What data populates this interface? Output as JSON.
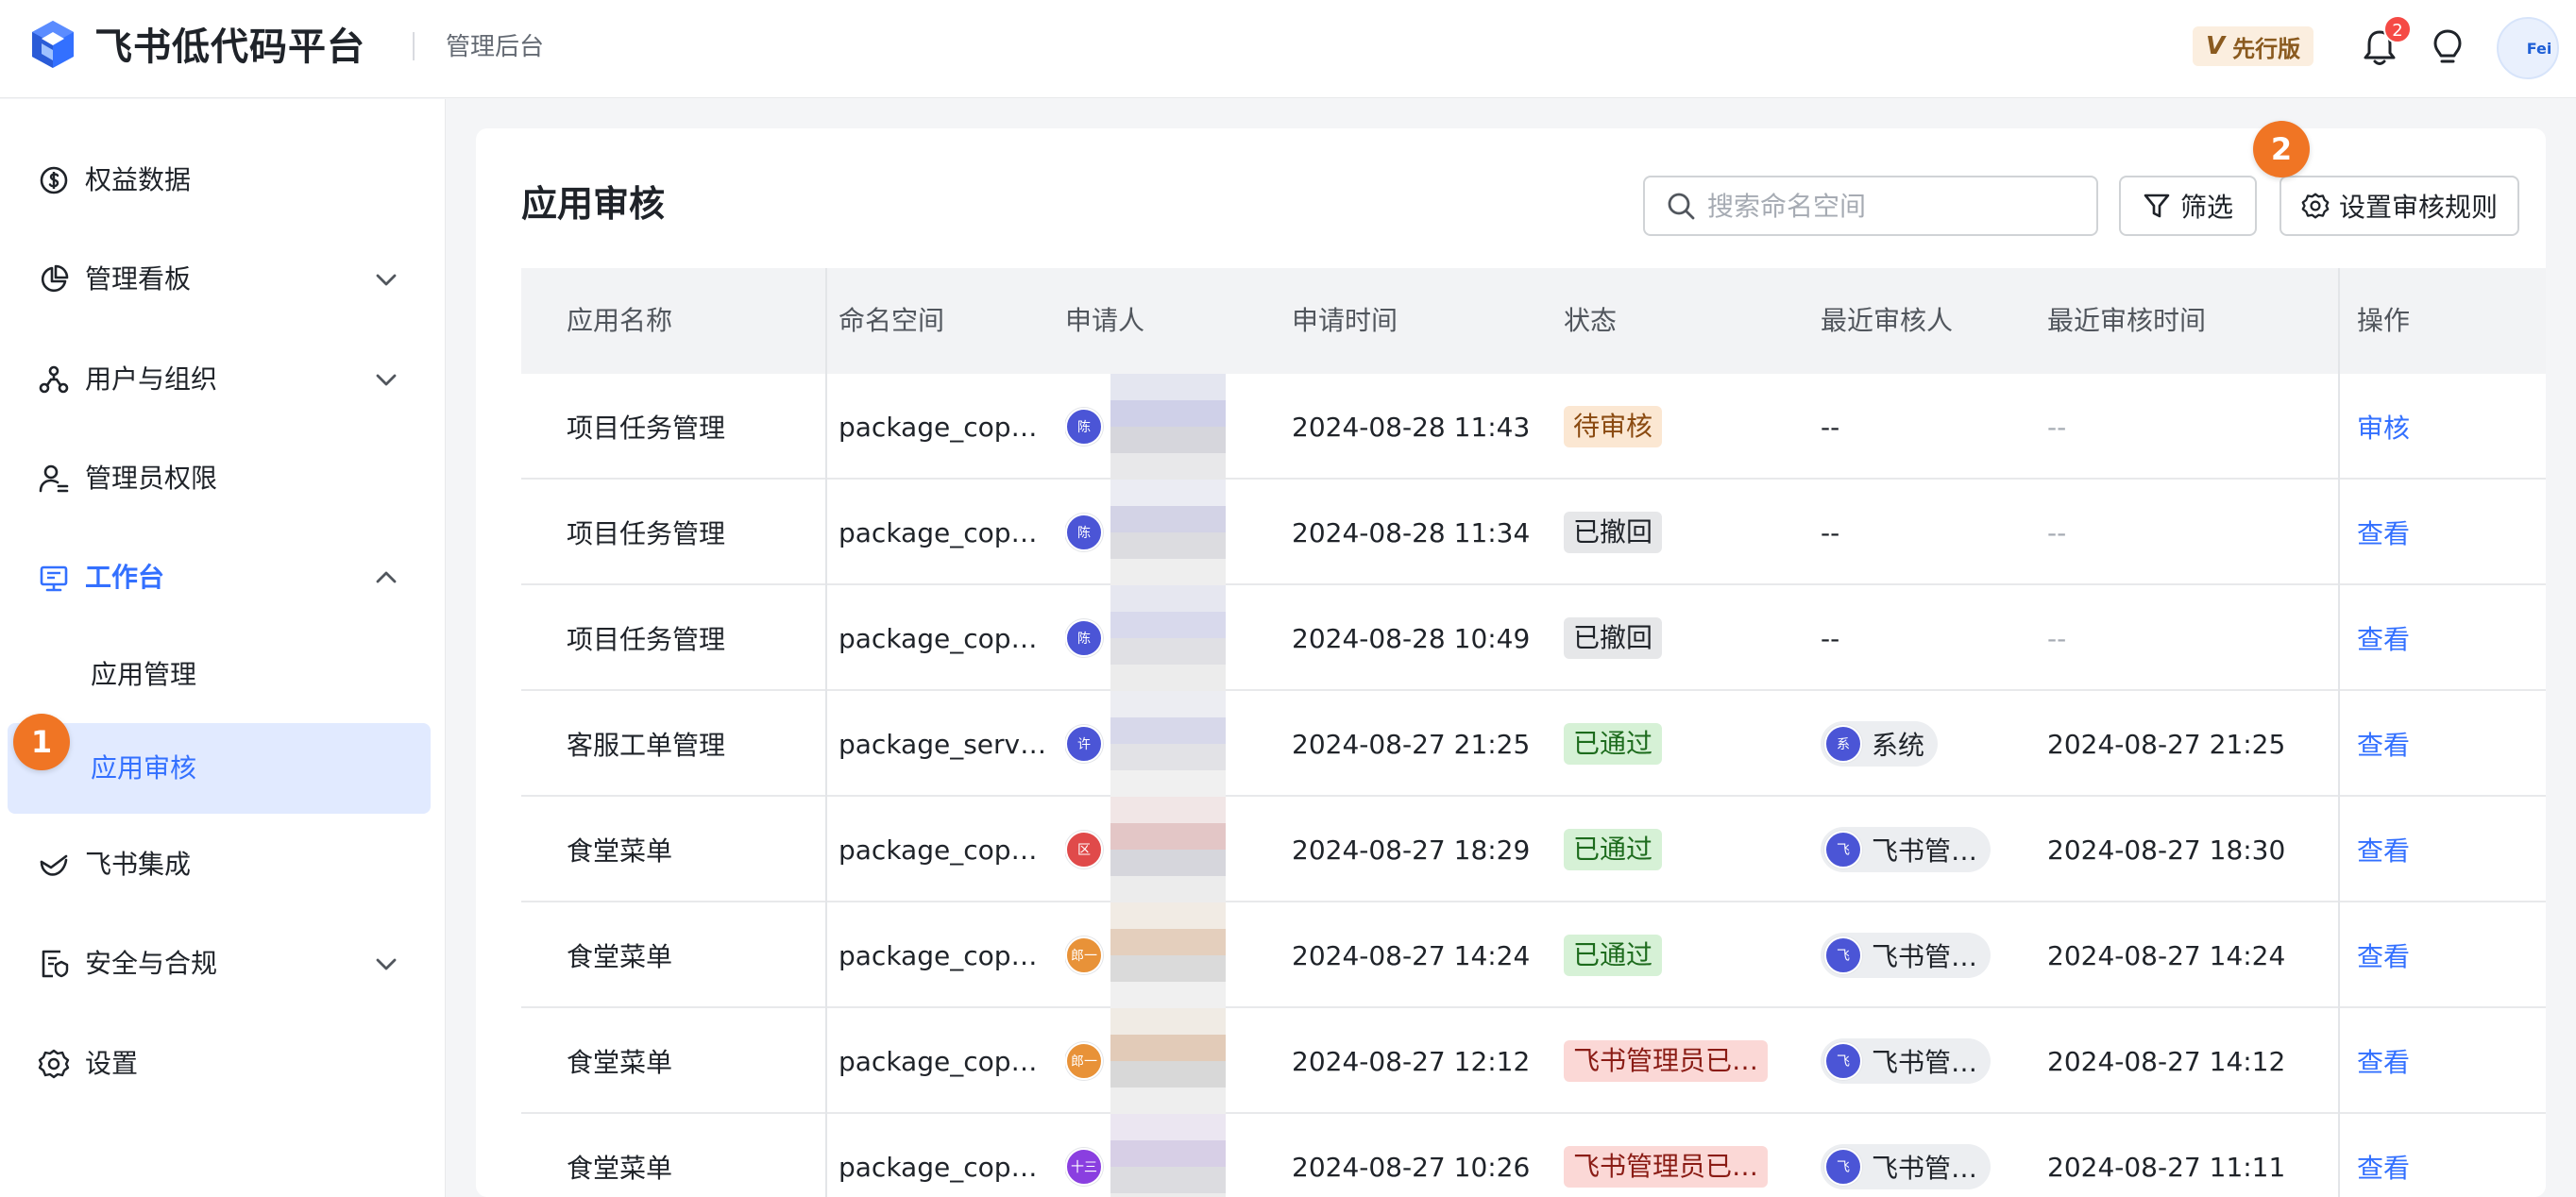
{
  "header": {
    "brand": "飞书低代码平台",
    "subtitle": "管理后台",
    "version_badge": "先行版",
    "version_mark": "V",
    "notification_count": "2",
    "avatar_text": "Fei"
  },
  "sidebar": {
    "items": [
      {
        "label": "权益数据",
        "icon": "dollar-circle-icon"
      },
      {
        "label": "管理看板",
        "icon": "pie-chart-icon",
        "has_chevron": true
      },
      {
        "label": "用户与组织",
        "icon": "org-tree-icon",
        "has_chevron": true
      },
      {
        "label": "管理员权限",
        "icon": "admin-user-icon"
      },
      {
        "label": "工作台",
        "icon": "monitor-icon",
        "expanded": true
      },
      {
        "label": "飞书集成",
        "icon": "integration-icon"
      },
      {
        "label": "安全与合规",
        "icon": "shield-doc-icon",
        "has_chevron": true
      },
      {
        "label": "设置",
        "icon": "gear-icon"
      }
    ],
    "subitems": [
      {
        "label": "应用管理"
      },
      {
        "label": "应用审核",
        "selected": true
      }
    ]
  },
  "markers": [
    "1",
    "2"
  ],
  "main": {
    "title": "应用审核",
    "search_placeholder": "搜索命名空间",
    "filter_label": "筛选",
    "rules_label": "设置审核规则",
    "columns": [
      "应用名称",
      "命名空间",
      "申请人",
      "申请时间",
      "状态",
      "最近审核人",
      "最近审核时间",
      "操作"
    ],
    "rows": [
      {
        "app": "项目任务管理",
        "namespace": "package_cop…",
        "applicant_avatar": "陈",
        "avatar_color": "#4b55d6",
        "time": "2024-08-28 11:43",
        "status": "待审核",
        "status_type": "pending",
        "reviewer_avatar": "",
        "reviewer": "--",
        "review_time": "--",
        "action": "审核"
      },
      {
        "app": "项目任务管理",
        "namespace": "package_cop…",
        "applicant_avatar": "陈",
        "avatar_color": "#4b55d6",
        "time": "2024-08-28 11:34",
        "status": "已撤回",
        "status_type": "revoked",
        "reviewer_avatar": "",
        "reviewer": "--",
        "review_time": "--",
        "action": "查看"
      },
      {
        "app": "项目任务管理",
        "namespace": "package_cop…",
        "applicant_avatar": "陈",
        "avatar_color": "#4b55d6",
        "time": "2024-08-28 10:49",
        "status": "已撤回",
        "status_type": "revoked",
        "reviewer_avatar": "",
        "reviewer": "--",
        "review_time": "--",
        "action": "查看"
      },
      {
        "app": "客服工单管理",
        "namespace": "package_serv…",
        "applicant_avatar": "许",
        "avatar_color": "#4b55d6",
        "time": "2024-08-27 21:25",
        "status": "已通过",
        "status_type": "passed",
        "reviewer_avatar": "系",
        "reviewer": "系统",
        "review_time": "2024-08-27 21:25",
        "action": "查看"
      },
      {
        "app": "食堂菜单",
        "namespace": "package_cop…",
        "applicant_avatar": "区",
        "avatar_color": "#e04a4a",
        "time": "2024-08-27 18:29",
        "status": "已通过",
        "status_type": "passed",
        "reviewer_avatar": "飞",
        "reviewer": "飞书管…",
        "review_time": "2024-08-27 18:30",
        "action": "查看"
      },
      {
        "app": "食堂菜单",
        "namespace": "package_cop…",
        "applicant_avatar": "郎一",
        "avatar_color": "#e89238",
        "time": "2024-08-27 14:24",
        "status": "已通过",
        "status_type": "passed",
        "reviewer_avatar": "飞",
        "reviewer": "飞书管…",
        "review_time": "2024-08-27 14:24",
        "action": "查看"
      },
      {
        "app": "食堂菜单",
        "namespace": "package_cop…",
        "applicant_avatar": "郎一",
        "avatar_color": "#e89238",
        "time": "2024-08-27 12:12",
        "status": "飞书管理员已…",
        "status_type": "rejected",
        "reviewer_avatar": "飞",
        "reviewer": "飞书管…",
        "review_time": "2024-08-27 14:12",
        "action": "查看"
      },
      {
        "app": "食堂菜单",
        "namespace": "package_cop…",
        "applicant_avatar": "十三",
        "avatar_color": "#8a3fe0",
        "time": "2024-08-27 10:26",
        "status": "飞书管理员已…",
        "status_type": "rejected",
        "reviewer_avatar": "飞",
        "reviewer": "飞书管…",
        "review_time": "2024-08-27 11:11",
        "action": "查看"
      }
    ]
  },
  "colors": {
    "accent": "#3370ff",
    "marker": "#f07524",
    "reviewer_avatar": "#4b55d6"
  }
}
